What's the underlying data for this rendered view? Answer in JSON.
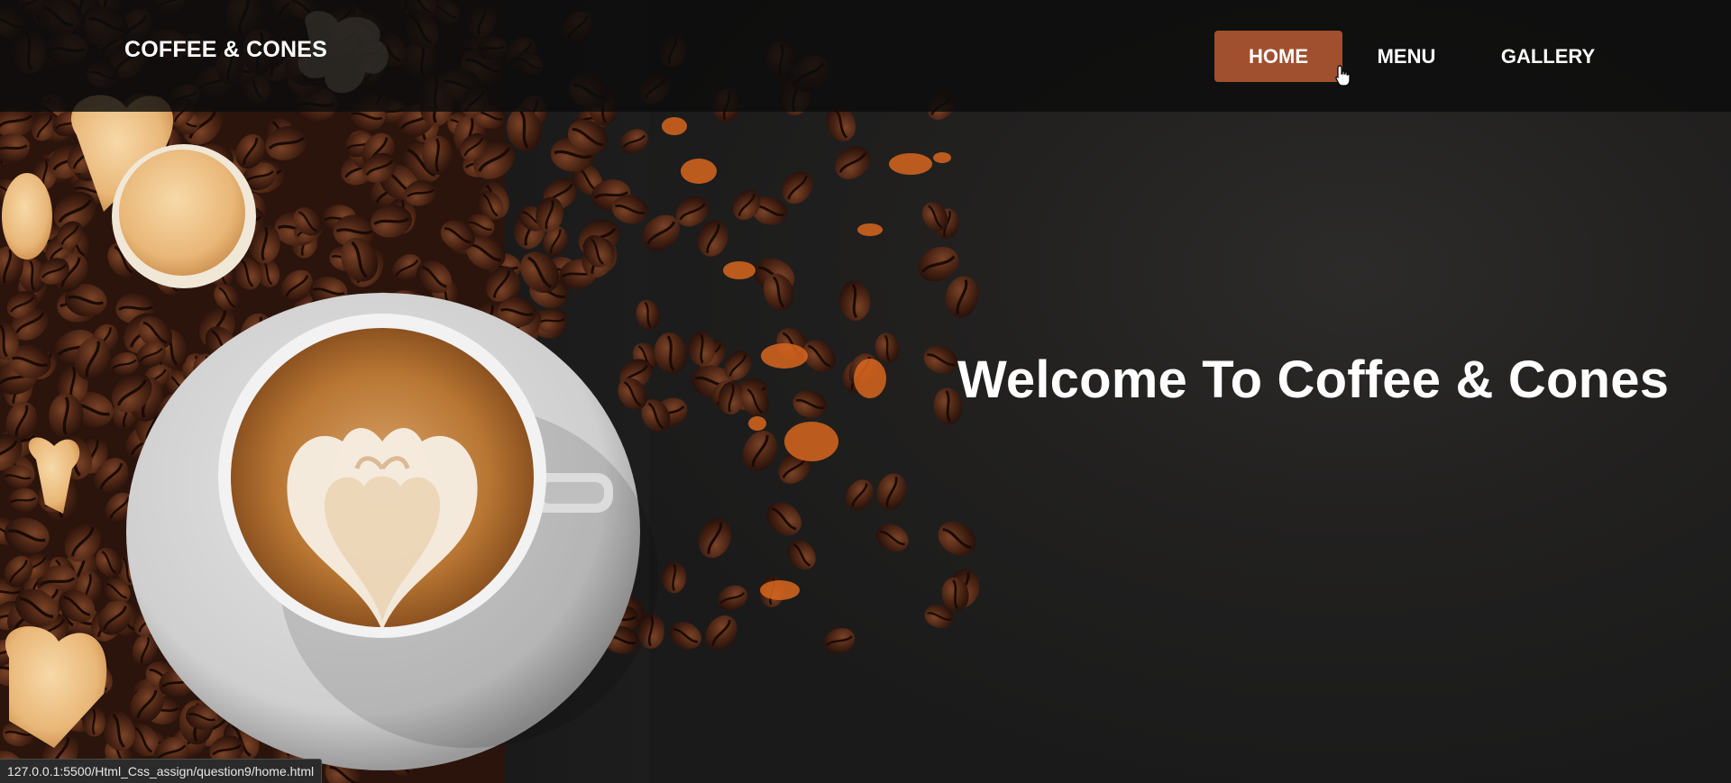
{
  "brand": {
    "name": "COFFEE & CONES"
  },
  "nav": {
    "items": [
      {
        "label": "HOME",
        "active": true
      },
      {
        "label": "MENU",
        "active": false
      },
      {
        "label": "GALLERY",
        "active": false
      }
    ],
    "active_color": "#a0502e"
  },
  "hero": {
    "title": "Welcome To Coffee & Cones",
    "image_subject": "latte-art-cup-with-coffee-beans"
  },
  "status_bar": {
    "url": "127.0.0.1:5500/Html_Css_assign/question9/home.html"
  },
  "icons": {
    "cursor": "hand-pointer-icon"
  }
}
